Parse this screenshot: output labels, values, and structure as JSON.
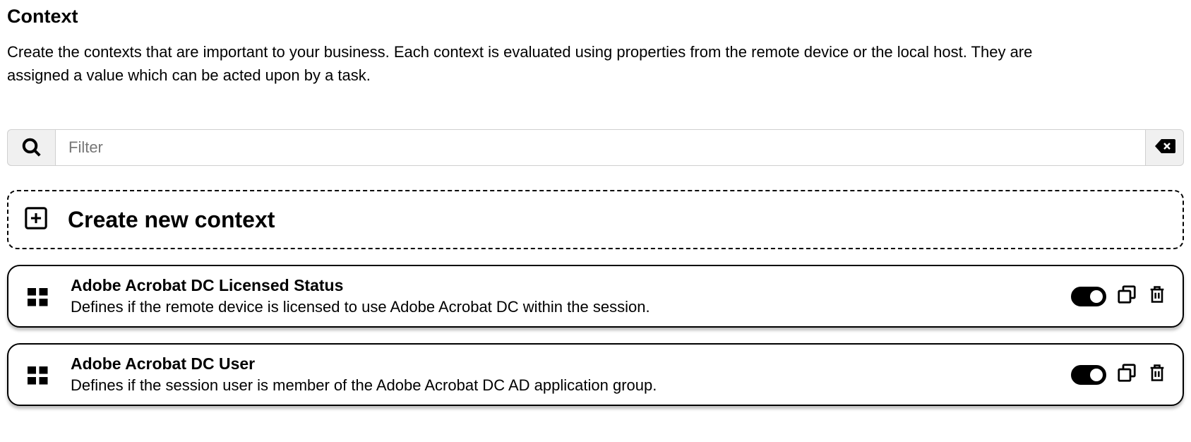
{
  "header": {
    "title": "Context",
    "description": "Create the contexts that are important to your business. Each context is evaluated using properties from the remote device or the local host. They are assigned a value which can be acted upon by a task."
  },
  "filter": {
    "placeholder": "Filter",
    "value": ""
  },
  "create": {
    "label": "Create new context"
  },
  "contexts": [
    {
      "title": "Adobe Acrobat DC Licensed Status",
      "description": "Defines if the remote device is licensed to use Adobe Acrobat DC within the session.",
      "enabled": true
    },
    {
      "title": "Adobe Acrobat DC User",
      "description": "Defines if the session user is member of the Adobe Acrobat DC AD application group.",
      "enabled": true
    }
  ]
}
